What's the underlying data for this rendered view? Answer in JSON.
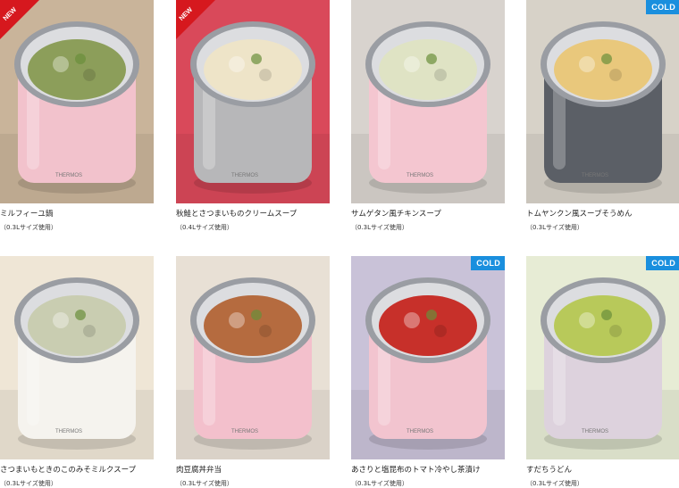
{
  "products": [
    {
      "title": "ミルフィーユ鍋",
      "size": "（0.3Lサイズ使用）",
      "badge": "NEW",
      "jar": "#f2c2cc",
      "bg": "#c9b49a",
      "food": "#8c9e5a"
    },
    {
      "title": "秋鮭とさつまいものクリームスープ",
      "size": "（0.4Lサイズ使用）",
      "badge": "NEW",
      "jar": "#b7b7b9",
      "bg": "#d9495a",
      "food": "#eee4c8"
    },
    {
      "title": "サムゲタン風チキンスープ",
      "size": "（0.3Lサイズ使用）",
      "badge": "",
      "jar": "#f4c6d0",
      "bg": "#d8d3ce",
      "food": "#dfe3c4"
    },
    {
      "title": "トムヤンクン風スープそうめん",
      "size": "（0.3Lサイズ使用）",
      "badge": "COLD",
      "jar": "#5b5f66",
      "bg": "#d7d2c8",
      "food": "#e9c87c"
    },
    {
      "title": "さつまいもときのこのみそミルクスープ",
      "size": "（0.3Lサイズ使用）",
      "badge": "",
      "jar": "#f5f3ee",
      "bg": "#efe6d6",
      "food": "#c9cdb1"
    },
    {
      "title": "肉豆腐丼弁当",
      "size": "（0.3Lサイズ使用）",
      "badge": "",
      "jar": "#f3c0cc",
      "bg": "#e8e0d5",
      "food": "#b56b3f"
    },
    {
      "title": "あさりと塩昆布のトマト冷やし茶漬け",
      "size": "（0.3Lサイズ使用）",
      "badge": "COLD",
      "jar": "#f2c4cf",
      "bg": "#c9c2d8",
      "food": "#c7302a"
    },
    {
      "title": "すだちうどん",
      "size": "（0.3Lサイズ使用）",
      "badge": "COLD",
      "jar": "#ddd2dd",
      "bg": "#e7ecd5",
      "food": "#b8c95a"
    }
  ]
}
